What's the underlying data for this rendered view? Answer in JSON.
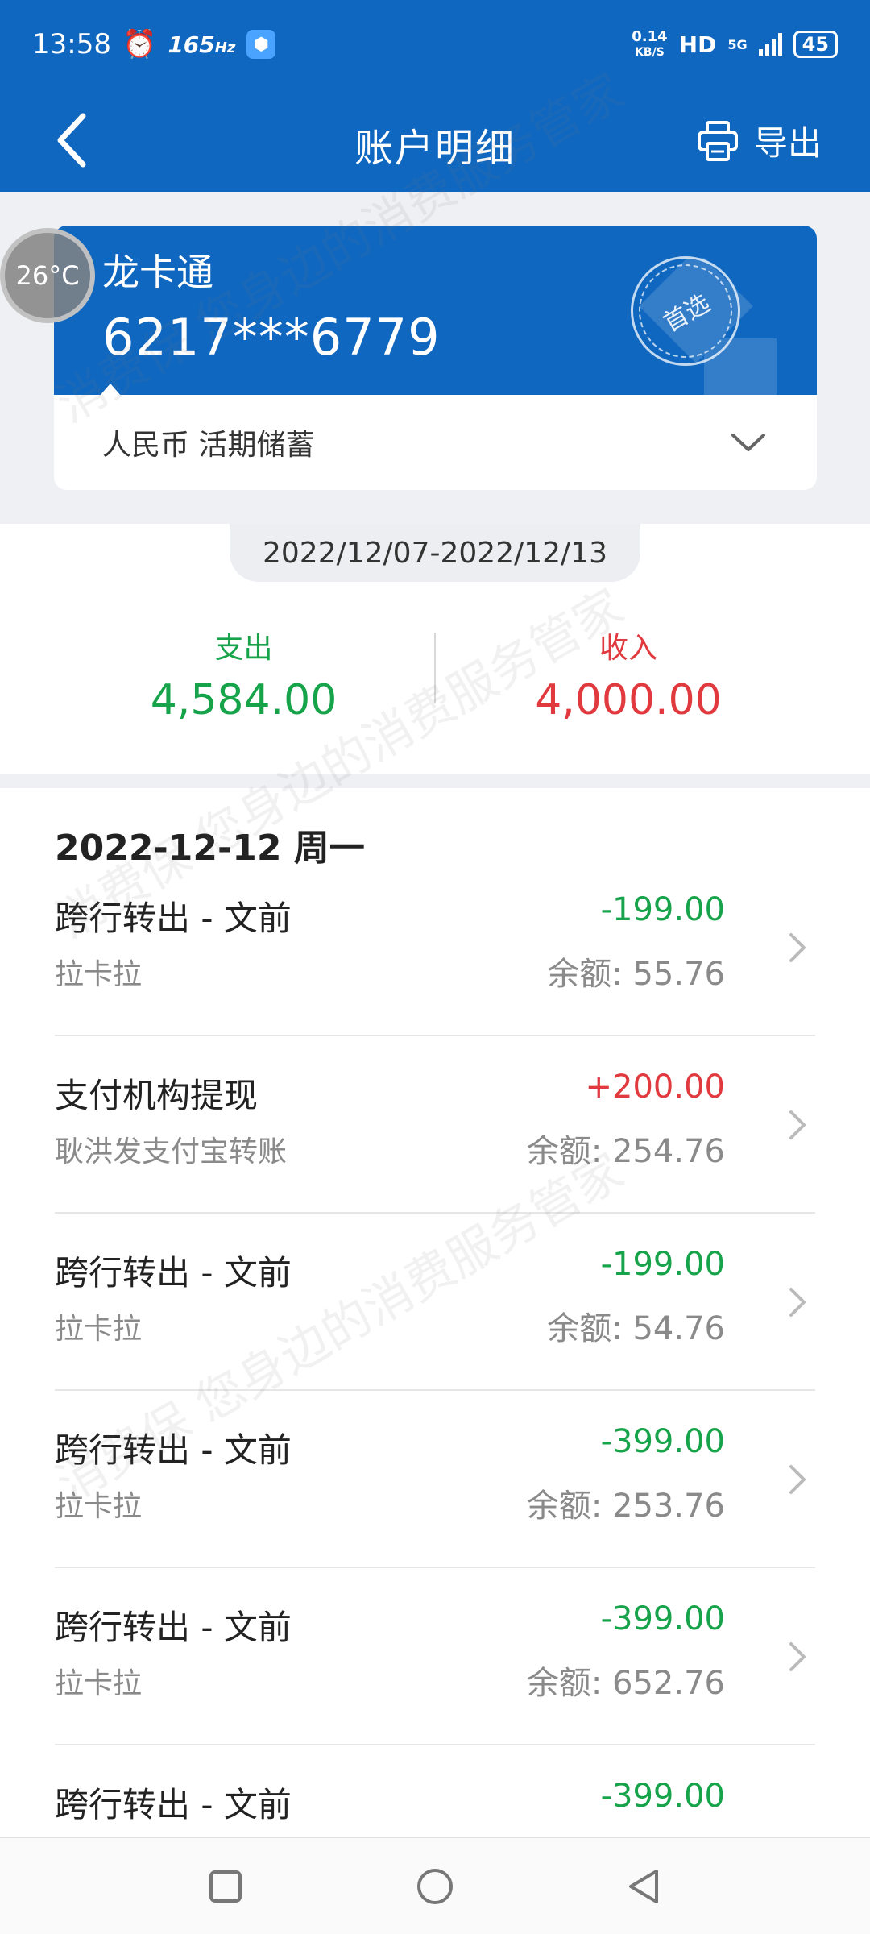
{
  "status": {
    "time": "13:58",
    "refresh_rate": "165",
    "refresh_unit": "Hz",
    "net_speed": "0.14",
    "net_unit": "KB/S",
    "hd": "HD",
    "network": "5G",
    "battery": "45"
  },
  "header": {
    "title": "账户明细",
    "export_label": "导出"
  },
  "card": {
    "name": "龙卡通",
    "number": "6217***6779",
    "stamp": "首选",
    "account_type": "人民币 活期储蓄"
  },
  "temp": "26°C",
  "summary": {
    "date_range": "2022/12/07-2022/12/13",
    "expense_label": "支出",
    "expense_value": "4,584.00",
    "income_label": "收入",
    "income_value": "4,000.00"
  },
  "list": {
    "date_header": "2022-12-12 周一",
    "transactions": [
      {
        "title": "跨行转出 - 文前",
        "sub": "拉卡拉",
        "amount": "-199.00",
        "balance": "余额: 55.76",
        "type": "out"
      },
      {
        "title": "支付机构提现",
        "sub": "耿洪发支付宝转账",
        "amount": "+200.00",
        "balance": "余额: 254.76",
        "type": "in"
      },
      {
        "title": "跨行转出 - 文前",
        "sub": "拉卡拉",
        "amount": "-199.00",
        "balance": "余额: 54.76",
        "type": "out"
      },
      {
        "title": "跨行转出 - 文前",
        "sub": "拉卡拉",
        "amount": "-399.00",
        "balance": "余额: 253.76",
        "type": "out"
      },
      {
        "title": "跨行转出 - 文前",
        "sub": "拉卡拉",
        "amount": "-399.00",
        "balance": "余额: 652.76",
        "type": "out"
      },
      {
        "title": "跨行转出 - 文前",
        "sub": "",
        "amount": "-399.00",
        "balance": "",
        "type": "out"
      }
    ]
  },
  "watermark": "消费保 您身边的消费服务管家",
  "colors": {
    "primary": "#1067c0",
    "expense": "#16a34a",
    "income": "#e0393e"
  }
}
